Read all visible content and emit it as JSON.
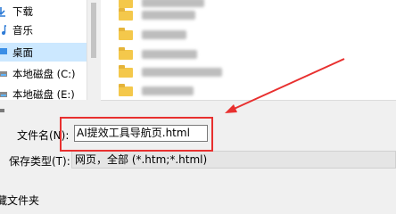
{
  "nav": {
    "items": [
      {
        "label": "下载",
        "icon": "download-icon",
        "selected": false
      },
      {
        "label": "音乐",
        "icon": "music-icon",
        "selected": false
      },
      {
        "label": "桌面",
        "icon": "desktop-icon",
        "selected": true
      },
      {
        "label": "本地磁盘 (C:)",
        "icon": "drive-icon",
        "selected": false
      },
      {
        "label": "本地磁盘 (E:)",
        "icon": "drive-icon",
        "selected": false
      },
      {
        "label": "",
        "icon": "network-icon",
        "selected": false
      }
    ]
  },
  "form": {
    "filename_label": "文件名(N):",
    "filename_value": "AI提效工具导航页.html",
    "filetype_label": "保存类型(T):",
    "filetype_value": "网页，全部 (*.htm;*.html)"
  },
  "footer": {
    "hide_folders_label": "藏文件夹"
  },
  "annotation": {
    "color": "#e8302f"
  }
}
